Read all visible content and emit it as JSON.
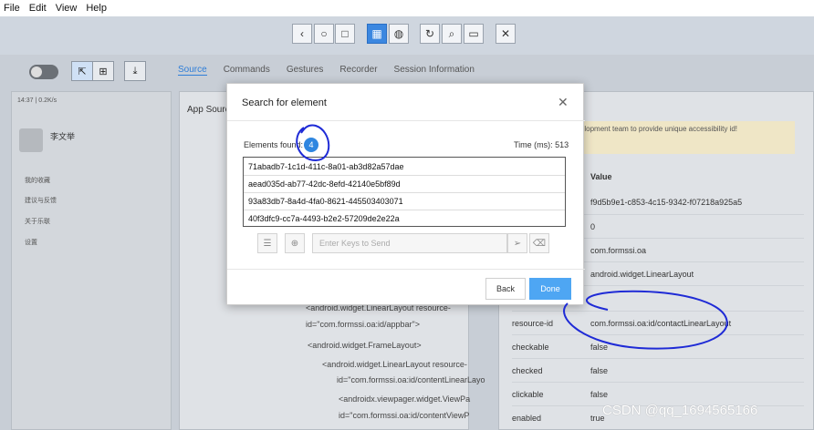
{
  "menu": [
    "File",
    "Edit",
    "View",
    "Help"
  ],
  "toolbar": {
    "icons": [
      "back-icon",
      "home-icon",
      "stop-icon",
      "grid-icon",
      "globe-icon",
      "refresh-icon",
      "search-icon",
      "record-icon",
      "close-icon"
    ]
  },
  "inspector_tabs": [
    "Source",
    "Commands",
    "Gestures",
    "Recorder",
    "Session Information"
  ],
  "phone": {
    "status": "14:37 | 0.2K/s",
    "user_name": "李文举",
    "items": [
      "我的收藏",
      "建议与反馈",
      "关于乐联",
      "设置"
    ]
  },
  "source_panel": {
    "title": "App Source",
    "tree": [
      "<android.widget.LinearLayout resource-",
      "id=\"com.formssi.oa:id/appbar\">",
      "<android.widget.FrameLayout>",
      "<android.widget.LinearLayout resource-",
      "id=\"com.formssi.oa:id/contentLinearLayo",
      "<androidx.viewpager.widget.ViewPa",
      "id=\"com.formssi.oa:id/contentViewP"
    ]
  },
  "attr_panel": {
    "notice": "development team to provide unique accessibility id!",
    "header": "Value",
    "rows": [
      {
        "k": "",
        "v": "f9d5b9e1-c853-4c15-9342-f07218a925a5"
      },
      {
        "k": "",
        "v": "0"
      },
      {
        "k": "",
        "v": "com.formssi.oa"
      },
      {
        "k": "",
        "v": "android.widget.LinearLayout"
      },
      {
        "k": "",
        "v": ""
      },
      {
        "k": "resource-id",
        "v": "com.formssi.oa:id/contactLinearLayout"
      },
      {
        "k": "checkable",
        "v": "false"
      },
      {
        "k": "checked",
        "v": "false"
      },
      {
        "k": "clickable",
        "v": "false"
      },
      {
        "k": "enabled",
        "v": "true"
      }
    ]
  },
  "modal": {
    "title": "Search for element",
    "elements_found_label": "Elements found:",
    "elements_found_count": "4",
    "time_label": "Time (ms): 513",
    "results": [
      "71abadb7-1c1d-411c-8a01-ab3d82a57dae",
      "aead035d-ab77-42dc-8efd-42140e5bf89d",
      "93a83db7-8a4d-4fa0-8621-445503403071",
      "40f3dfc9-cc7a-4493-b2e2-57209de2e22a"
    ],
    "keys_placeholder": "Enter Keys to Send",
    "back_label": "Back",
    "done_label": "Done"
  },
  "watermark": "CSDN @qq_1694565166"
}
